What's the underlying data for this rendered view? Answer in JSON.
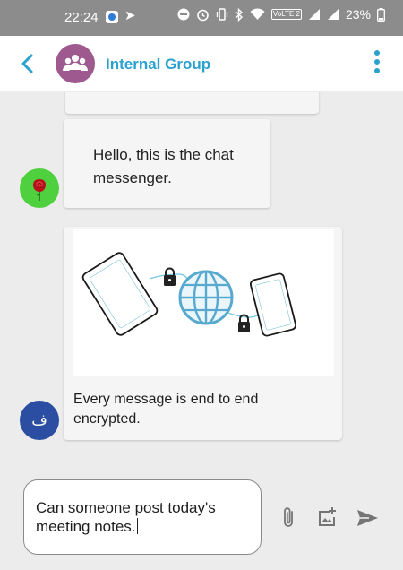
{
  "status_bar": {
    "time": "22:24",
    "volte": "VoLTE 2",
    "battery": "23%"
  },
  "header": {
    "title": "Internal Group",
    "accent_color": "#2aa1cf"
  },
  "messages": [
    {
      "id": "msg-1",
      "text": "Hello, this is the chat messenger."
    },
    {
      "id": "msg-2",
      "caption": "Every message is end to end encrypted."
    }
  ],
  "avatars": {
    "sender_f": "ف"
  },
  "composer": {
    "value": "Can someone post today's meeting notes."
  },
  "icons": {
    "back": "chevron-left-icon",
    "more": "more-vertical-icon",
    "attach": "paperclip-icon",
    "image": "add-image-icon",
    "send": "send-icon"
  }
}
